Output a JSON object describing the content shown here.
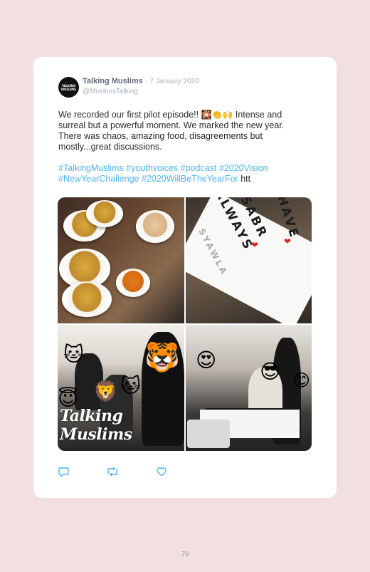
{
  "tweet": {
    "avatar_text": "TALKING MUSLIMS",
    "display_name": "Talking Muslims",
    "separator": "·",
    "date": "7 January 2020",
    "handle": "@MuslimsTalking",
    "text_before_emoji": "We recorded our first pilot episode!! ",
    "emoji": "🎇👏🙌",
    "text_after_emoji": " Intense and surreal but a powerful moment. We marked the new year. There was chaos, amazing food, disagreements but mostly...great discussions.",
    "hashtags": [
      "#TalkingMuslims",
      "#youthvoices",
      "#podcast",
      "#2020Vision",
      "#NewYearChallenge",
      "#2020WillBeTheYearFor"
    ],
    "truncated_link": "htt"
  },
  "media": {
    "photo_1": "food-dishes-photo",
    "photo_2": "lightbox-sign-photo",
    "photo_2_lines": [
      "HAVE",
      "SABR",
      "ALWAYS",
      "SYAWLA"
    ],
    "photo_3_watermark": "Talking Muslims",
    "photo_4": "podcast-recording-photo"
  },
  "actions": {
    "reply_icon": "reply-icon",
    "retweet_icon": "retweet-icon",
    "like_icon": "heart-icon"
  },
  "page_number": "79"
}
